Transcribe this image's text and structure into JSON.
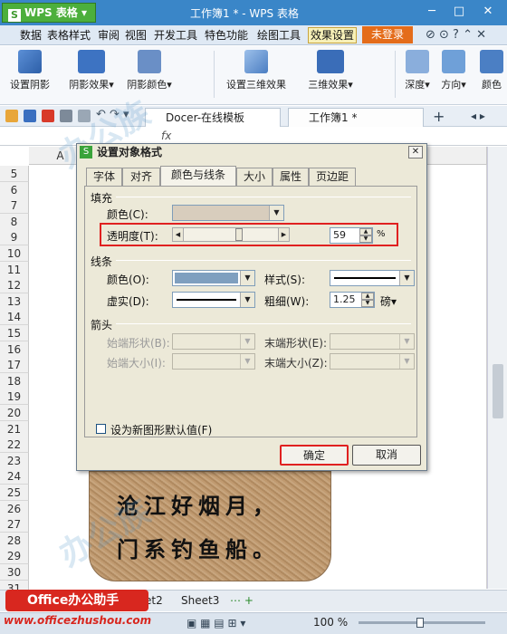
{
  "app": {
    "name": "WPS 表格",
    "window_title": "工作簿1 * - WPS 表格"
  },
  "menu": [
    "数据",
    "表格样式",
    "审阅",
    "视图",
    "开发工具",
    "特色功能",
    "绘图工具",
    "效果设置"
  ],
  "menu_active": "效果设置",
  "login_label": "未登录",
  "ribbon": [
    "设置阴影",
    "阴影效果",
    "阴影颜色",
    "设置三维效果",
    "三维效果",
    "深度",
    "方向",
    "颜色"
  ],
  "tabs": [
    {
      "label": "Docer-在线模板"
    },
    {
      "label": "工作簿1 *"
    }
  ],
  "formula_bar": {
    "fx": "fx",
    "name_box": ""
  },
  "columns": [
    "A"
  ],
  "rows": [
    "5",
    "6",
    "7",
    "8",
    "9",
    "10",
    "11",
    "12",
    "13",
    "14",
    "15",
    "16",
    "17",
    "18",
    "19",
    "20",
    "21",
    "22",
    "23",
    "24",
    "25",
    "26",
    "27",
    "28",
    "29",
    "30",
    "31"
  ],
  "shape_text": [
    "沧江好烟月，",
    "门系钓鱼船。"
  ],
  "sheet_tabs": [
    "et2",
    "Sheet3"
  ],
  "status": {
    "zoom": "100 %"
  },
  "branding": {
    "logo": "Office办公助手",
    "url": "www.officezhushou.com"
  },
  "dialog": {
    "title": "设置对象格式",
    "tabs": [
      "字体",
      "对齐",
      "颜色与线条",
      "大小",
      "属性",
      "页边距"
    ],
    "active_tab": "颜色与线条",
    "fill": {
      "group": "填充",
      "color_label": "颜色(C):",
      "transparency_label": "透明度(T):",
      "transparency_value": "59",
      "percent": "%",
      "transparency_fraction": 0.59
    },
    "line": {
      "group": "线条",
      "color_label": "颜色(O):",
      "style_label": "样式(S):",
      "dash_label": "虚实(D):",
      "weight_label": "粗细(W):",
      "weight_value": "1.25",
      "weight_unit": "磅",
      "line_color": "#7f9fbf"
    },
    "arrows": {
      "group": "箭头",
      "begin_style": "始端形状(B):",
      "end_style": "末端形状(E):",
      "begin_size": "始端大小(I):",
      "end_size": "末端大小(Z):"
    },
    "default_checkbox": "设为新图形默认值(F)",
    "ok": "确定",
    "cancel": "取消"
  },
  "colors": {
    "title_bar": "#3a86c8",
    "accent_red": "#e02020",
    "login": "#e46c1a",
    "logo_red": "#d8271f"
  }
}
